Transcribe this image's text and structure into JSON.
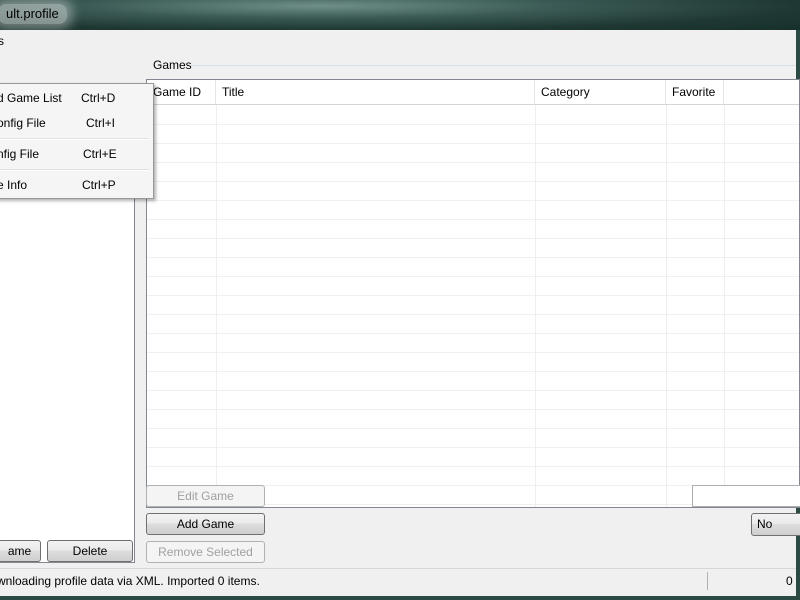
{
  "window": {
    "title": "ult.profile"
  },
  "menubar": {
    "items": [
      {
        "label": "s"
      }
    ]
  },
  "dropdown": {
    "items": [
      {
        "label": "d Game List",
        "shortcut": "Ctrl+D"
      },
      {
        "label": "onfig File",
        "shortcut": "Ctrl+I"
      },
      {
        "label": "nfig File",
        "shortcut": "Ctrl+E"
      },
      {
        "label": "e Info",
        "shortcut": "Ctrl+P"
      }
    ]
  },
  "left_panel": {
    "buttons": {
      "rename_label": "ame",
      "delete_label": "Delete"
    }
  },
  "games": {
    "group_label": "Games",
    "columns": [
      "Game ID",
      "Title",
      "Category",
      "Favorite"
    ],
    "rows": [],
    "buttons": {
      "edit_label": "Edit Game",
      "add_label": "Add Game",
      "remove_label": "Remove Selected"
    },
    "search_value": "",
    "favorite_filter": {
      "selected": "No"
    }
  },
  "statusbar": {
    "message": "wnloading profile data via XML. Imported 0 items.",
    "count": "0"
  }
}
